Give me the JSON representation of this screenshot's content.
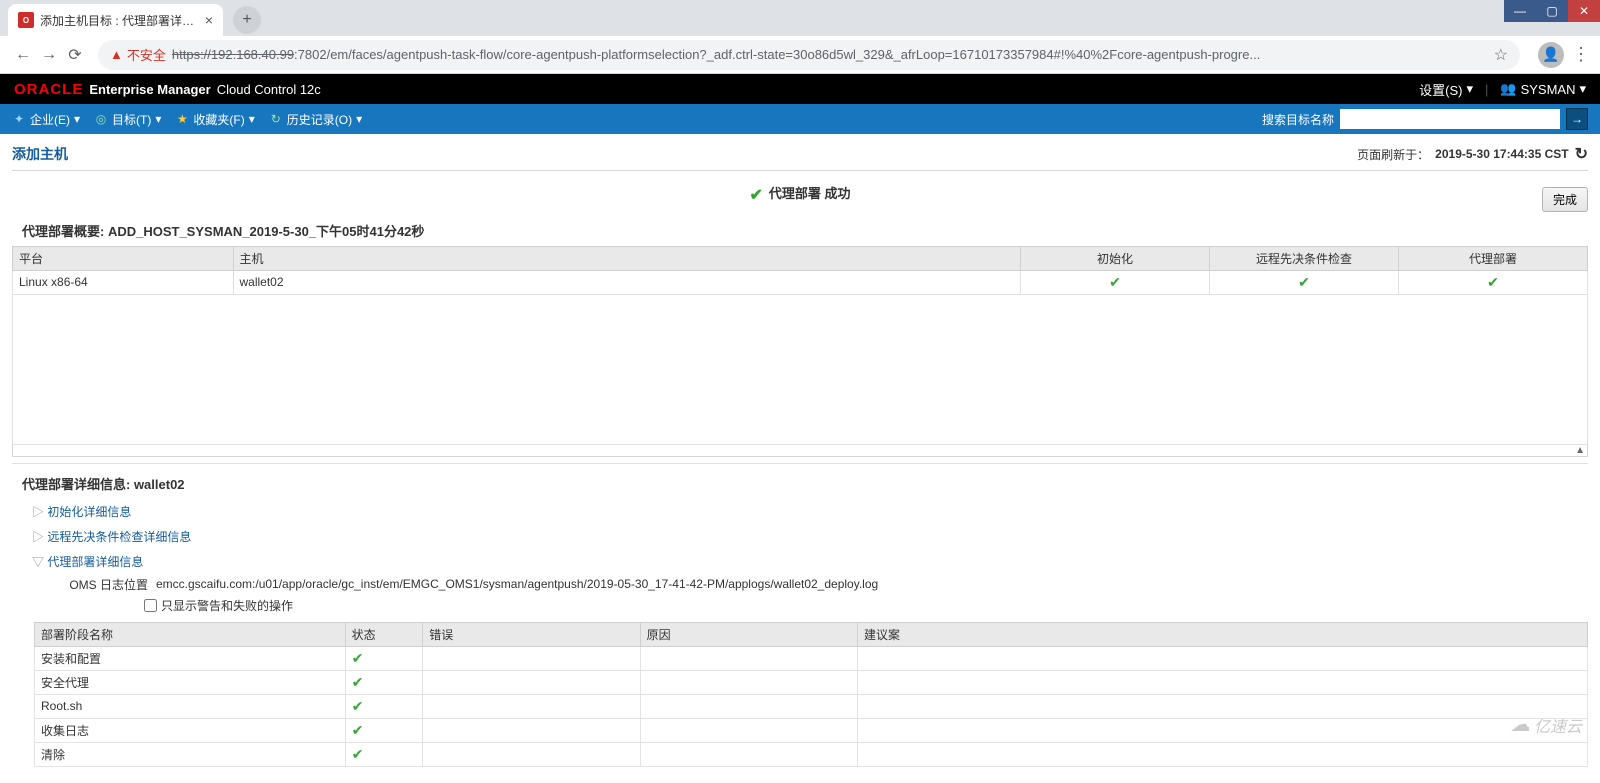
{
  "browser": {
    "tab_title": "添加主机目标 : 代理部署详细信息",
    "insecure_label": "不安全",
    "url_host": "https://192.168.40.99",
    "url_rest": ":7802/em/faces/agentpush-task-flow/core-agentpush-platformselection?_adf.ctrl-state=30o86d5wl_329&_afrLoop=16710173357984#!%40%2Fcore-agentpush-progre..."
  },
  "oracle_header": {
    "logo": "ORACLE",
    "product": "Enterprise Manager",
    "suffix": "Cloud Control 12c",
    "settings": "设置(S)",
    "user": "SYSMAN"
  },
  "menu": {
    "items": [
      {
        "label": "企业(E)",
        "icon": "✦"
      },
      {
        "label": "目标(T)",
        "icon": "◎"
      },
      {
        "label": "收藏夹(F)",
        "icon": "★"
      },
      {
        "label": "历史记录(O)",
        "icon": "↻"
      }
    ],
    "search_label": "搜索目标名称"
  },
  "page": {
    "title": "添加主机",
    "refresh_label": "页面刷新于：",
    "refresh_time": "2019-5-30 17:44:35 CST",
    "status_text": "代理部署 成功",
    "done_label": "完成",
    "summary_title": "代理部署概要: ADD_HOST_SYSMAN_2019-5-30_下午05时41分42秒"
  },
  "summary_table": {
    "headers": [
      "平台",
      "主机",
      "初始化",
      "远程先决条件检查",
      "代理部署"
    ],
    "row": {
      "platform": "Linux x86-64",
      "host": "wallet02"
    }
  },
  "details": {
    "title": "代理部署详细信息: wallet02",
    "sec1": "初始化详细信息",
    "sec2": "远程先决条件检查详细信息",
    "sec3": "代理部署详细信息",
    "oms_label": "OMS 日志位置",
    "oms_value": "emcc.gscaifu.com:/u01/app/oracle/gc_inst/em/EMGC_OMS1/sysman/agentpush/2019-05-30_17-41-42-PM/applogs/wallet02_deploy.log",
    "checkbox_label": "只显示警告和失败的操作",
    "table_headers": [
      "部署阶段名称",
      "状态",
      "错误",
      "原因",
      "建议案"
    ],
    "rows": [
      "安装和配置",
      "安全代理",
      "Root.sh",
      "收集日志",
      "清除"
    ]
  },
  "watermark": "亿速云"
}
